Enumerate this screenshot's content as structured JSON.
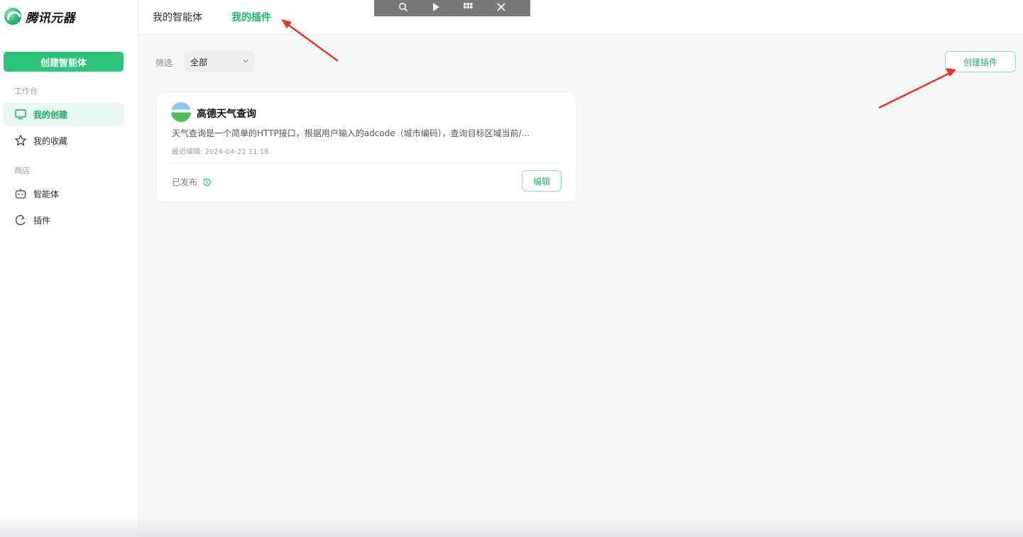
{
  "app": {
    "logo_text": "腾讯元器"
  },
  "sidebar": {
    "create_agent_label": "创建智能体",
    "section_workbench": "工作台",
    "section_store": "商店",
    "items": [
      {
        "label": "我的创建",
        "icon": "monitor-icon",
        "active": true
      },
      {
        "label": "我的收藏",
        "icon": "star-icon",
        "active": false
      },
      {
        "label": "智能体",
        "icon": "robot-icon",
        "active": false
      },
      {
        "label": "插件",
        "icon": "plugin-icon",
        "active": false
      }
    ]
  },
  "header": {
    "tabs": [
      {
        "label": "我的智能体",
        "active": false
      },
      {
        "label": "我的插件",
        "active": true
      }
    ],
    "overlay_icons": [
      "search-icon",
      "play-icon",
      "grid-icon",
      "close-icon"
    ]
  },
  "main": {
    "filter_label": "筛选",
    "filter_value": "全部",
    "create_plugin_label": "创建插件",
    "plugins": [
      {
        "title": "高德天气查询",
        "description": "天气查询是一个简单的HTTP接口，根据用户输入的adcode（城市编码），查询目标区域当前/...",
        "last_edited_label": "最近编辑:",
        "last_edited_value": "2024-04-22 11:18",
        "status": "已发布",
        "edit_label": "编辑"
      }
    ]
  },
  "colors": {
    "accent": "#2fc27a",
    "accent_text": "#22b36b",
    "annotation_arrow": "#e8322b"
  }
}
